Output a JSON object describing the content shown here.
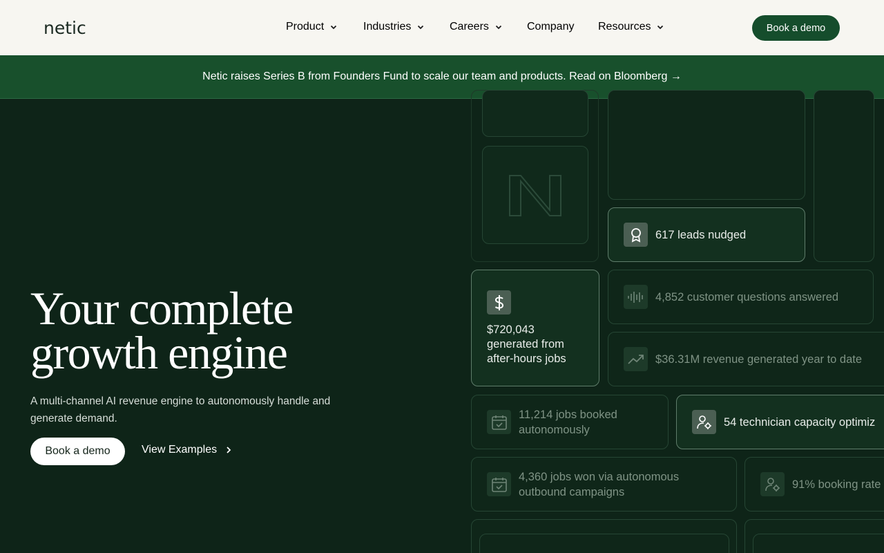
{
  "header": {
    "logo": "netic",
    "nav": [
      {
        "label": "Product",
        "has_menu": true
      },
      {
        "label": "Industries",
        "has_menu": true
      },
      {
        "label": "Careers",
        "has_menu": true
      },
      {
        "label": "Company",
        "has_menu": false
      },
      {
        "label": "Resources",
        "has_menu": true
      }
    ],
    "cta": "Book a demo"
  },
  "banner": {
    "text": "Netic raises Series B from Founders Fund to scale our team and products. Read on Bloomberg →"
  },
  "hero": {
    "title_line1": "Your complete",
    "title_line2": "growth engine",
    "subtitle": "A multi-channel AI revenue engine to autonomously handle and generate demand.",
    "primary_button": "Book a demo",
    "secondary_button": "View Examples"
  },
  "stats": {
    "leads": "617 leads nudged",
    "questions": "4,852 customer questions answered",
    "after_hours_amount": "$720,043",
    "after_hours_line2": "generated from",
    "after_hours_line3": "after-hours jobs",
    "revenue": "$36.31M revenue generated year to date",
    "jobs_booked_line1": "11,214 jobs booked",
    "jobs_booked_line2": "autonomously",
    "technician": "54 technician capacity optimiz",
    "jobs_won_line1": "4,360 jobs won via autonomous",
    "jobs_won_line2": "outbound campaigns",
    "booking_rate": "91% booking rate"
  },
  "colors": {
    "background": "#0e2418",
    "header": "#f7f6f1",
    "banner": "#18502c",
    "accent_button": "#154d2c"
  },
  "icons": [
    "chevron-down-icon",
    "award-icon",
    "dollar-icon",
    "waveform-icon",
    "trending-up-icon",
    "calendar-check-icon",
    "user-gear-icon",
    "chevron-right-icon",
    "netic-n-mark-icon"
  ]
}
